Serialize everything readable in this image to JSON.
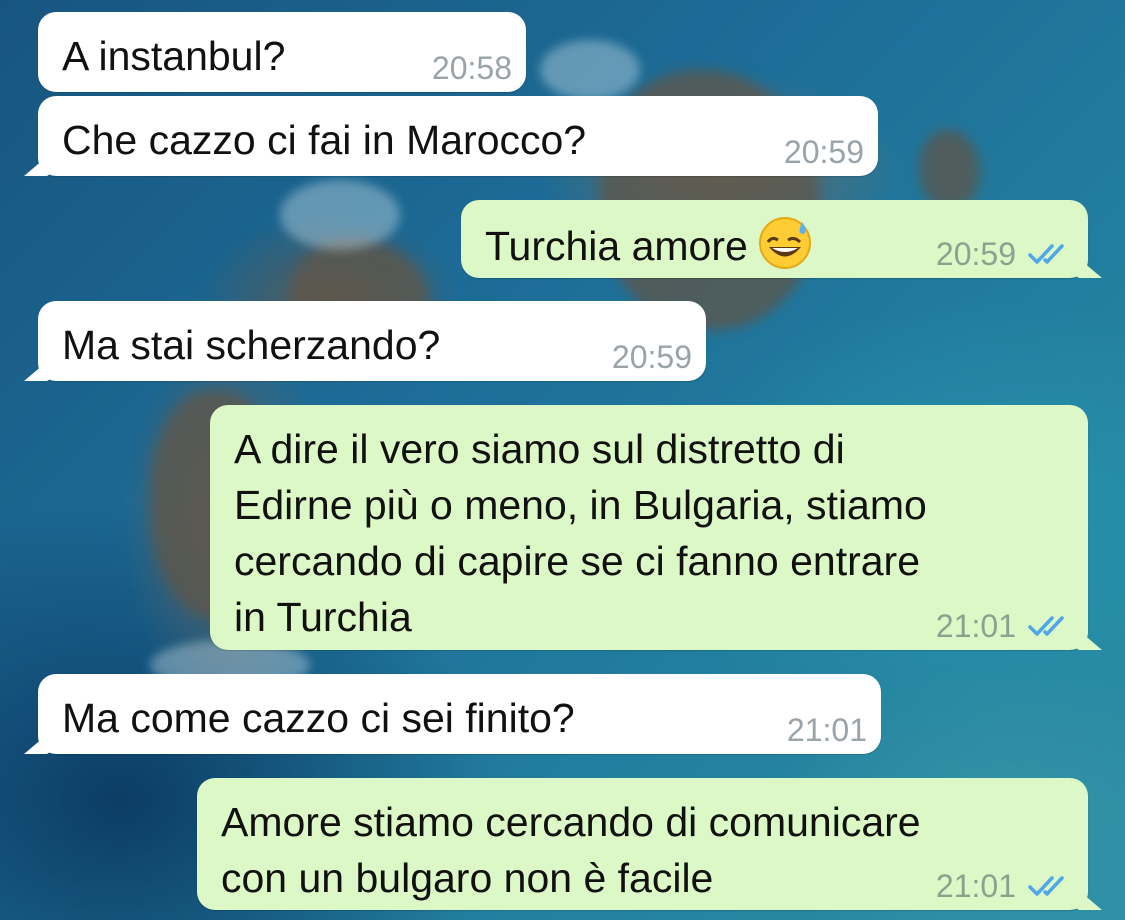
{
  "messages": [
    {
      "direction": "incoming",
      "text": "A instanbul?",
      "time": "20:58"
    },
    {
      "direction": "incoming",
      "text": "Che cazzo ci fai in Marocco?",
      "time": "20:59"
    },
    {
      "direction": "outgoing",
      "text": "Turchia amore",
      "emoji": "grinning-sweat-emoji",
      "time": "20:59",
      "status": "read-double-check-icon"
    },
    {
      "direction": "incoming",
      "text": "Ma stai scherzando?",
      "time": "20:59"
    },
    {
      "direction": "outgoing",
      "text": "A dire il vero siamo sul distretto di\nEdirne più o meno, in Bulgaria, stiamo\ncercando di capire se ci fanno entrare\nin Turchia",
      "time": "21:01",
      "status": "read-double-check-icon"
    },
    {
      "direction": "incoming",
      "text": "Ma come cazzo ci sei finito?",
      "time": "21:01"
    },
    {
      "direction": "outgoing",
      "text": "Amore stiamo cercando di comunicare\ncon un bulgaro non è facile",
      "time": "21:01",
      "status": "read-double-check-icon"
    }
  ],
  "colors": {
    "incoming_bubble": "#ffffff",
    "outgoing_bubble": "#dcf8c6",
    "read_ticks": "#4fa6e8"
  }
}
